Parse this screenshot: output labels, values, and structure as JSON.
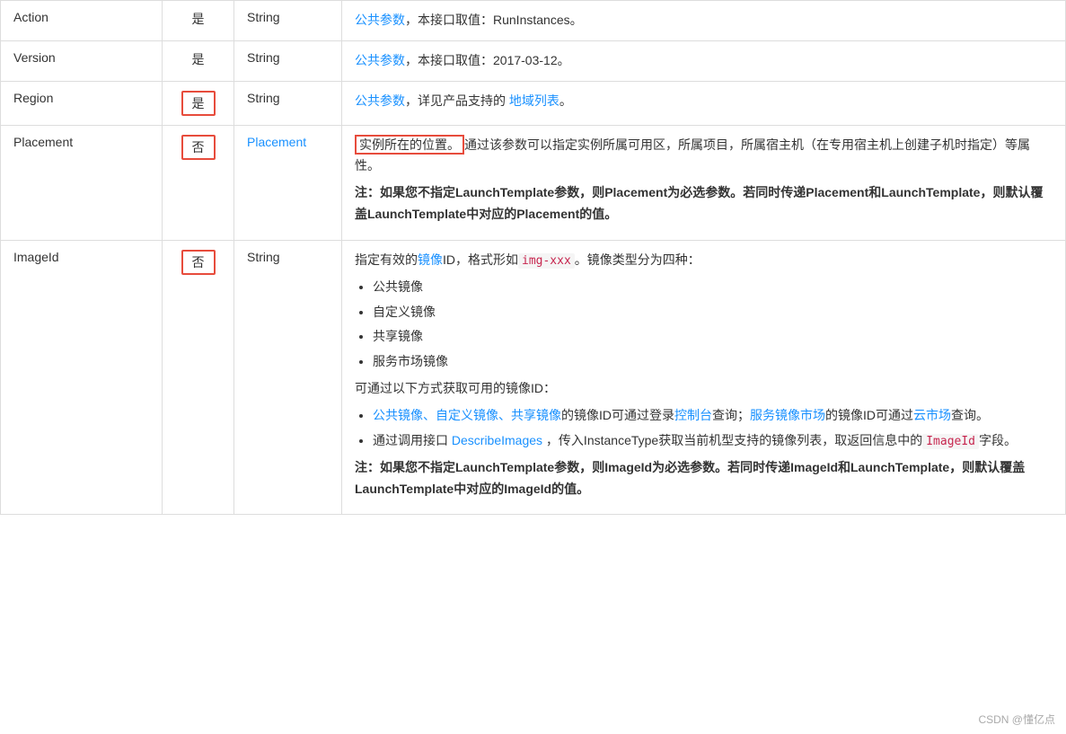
{
  "table": {
    "rows": [
      {
        "name": "Action",
        "required": "是",
        "type": "String",
        "description": {
          "type": "simple",
          "link_text": "公共参数",
          "text_after": "，本接口取值：RunInstances。"
        }
      },
      {
        "name": "Version",
        "required": "是",
        "type": "String",
        "description": {
          "type": "simple",
          "link_text": "公共参数",
          "text_after": "，本接口取值：2017-03-12。"
        }
      },
      {
        "name": "Region",
        "required": "是",
        "type": "String",
        "description": {
          "type": "region",
          "text_before": "公共参数",
          "text_middle": "，详见产品支持的 ",
          "link_text": "地域列表",
          "text_after": "。"
        }
      },
      {
        "name": "Placement",
        "required": "否",
        "type": "Placement",
        "description": {
          "type": "placement",
          "highlighted": "实例所在的位置。",
          "text1": "通过该参数可以指定实例所属可用区，所属项目，所属宿主机（在专用宿主机上创建子机时指定）等属性。",
          "bold": "注：如果您不指定LaunchTemplate参数，则Placement为必选参数。若同时传递Placement和LaunchTemplate，则默认覆盖LaunchTemplate中对应的Placement的值。"
        }
      },
      {
        "name": "ImageId",
        "required": "否",
        "type": "String",
        "description": {
          "type": "imageid",
          "text_intro1": "指定有效的",
          "link_image": "镜像",
          "text_intro2": "ID，格式形如",
          "code": "img-xxx",
          "text_intro3": "。镜像类型分为四种：",
          "list1": [
            "公共镜像",
            "自定义镜像",
            "共享镜像",
            "服务市场镜像"
          ],
          "text2": "可通过以下方式获取可用的镜像ID：",
          "bullet2_1_link1": "公共镜像、自定义镜像、共享镜像",
          "bullet2_1_mid": "的镜像ID可通过登录",
          "bullet2_1_link2": "控制台",
          "bullet2_1_mid2": "查询；",
          "bullet2_1_link3": "服务镜像市场",
          "bullet2_1_end": "的镜像ID可通过",
          "bullet2_1_link4": "云市场",
          "bullet2_1_end2": "查询。",
          "bullet2_2_pre": "通过调用接口 ",
          "bullet2_2_link": "DescribeImages",
          "bullet2_2_post": " ，传入InstanceType获取当前机型支持的镜像列表，取返回信息中的",
          "bullet2_2_code": "ImageId",
          "bullet2_2_end": "字段。",
          "bold": "注：如果您不指定LaunchTemplate参数，则ImageId为必选参数。若同时传递ImageId和LaunchTemplate，则默认覆盖LaunchTemplate中对应的ImageId的值。"
        }
      }
    ]
  },
  "watermark": "CSDN @懂亿点"
}
